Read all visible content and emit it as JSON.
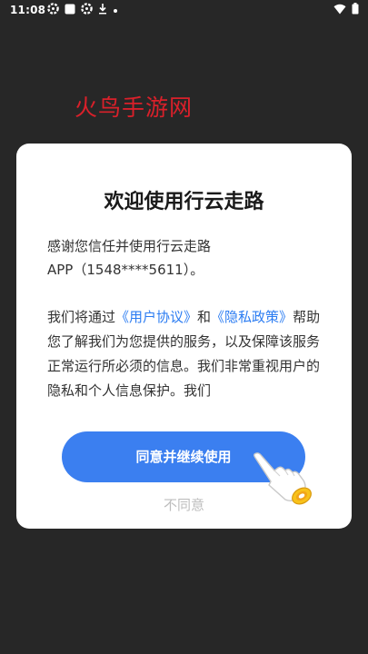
{
  "status_bar": {
    "time": "11:08",
    "icons": [
      "settings-gear-icon",
      "app-square-icon",
      "settings-gear-icon",
      "download-icon",
      "dot-icon"
    ],
    "right_icons": [
      "wifi-icon",
      "battery-icon"
    ]
  },
  "watermark": "火鸟手游网",
  "dialog": {
    "title": "欢迎使用行云走路",
    "intro_line1": "感谢您信任并使用行云走路",
    "intro_line2": "APP（1548****5611）。",
    "body": {
      "prefix": "我们将通过",
      "user_agreement": "《用户协议》",
      "and": "和",
      "privacy_policy": "《隐私政策》",
      "rest": "帮助您了解我们为您提供的服务，以及保障该服务正常运行所必须的信息。我们非常重视用户的隐私和个人信息保护。我们"
    },
    "agree_button": "同意并继续使用",
    "disagree_button": "不同意"
  },
  "colors": {
    "background": "#272727",
    "accent": "#3b7ff0",
    "link": "#2b7cf2",
    "watermark": "#d9202a"
  }
}
